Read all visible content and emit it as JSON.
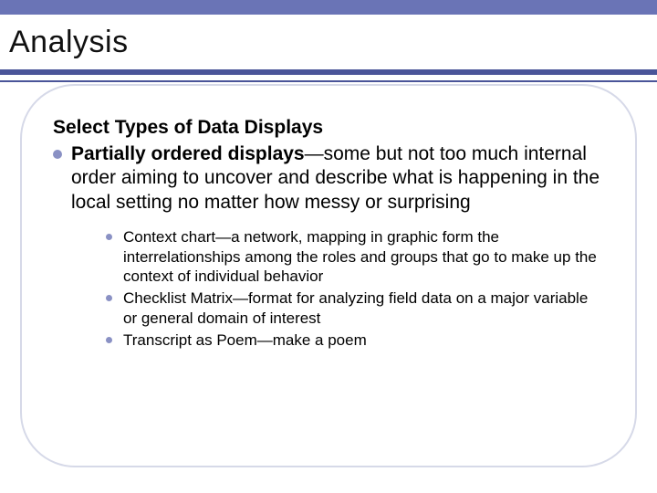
{
  "title": "Analysis",
  "heading": "Select Types of Data Displays",
  "item": {
    "label": "Partially ordered displays",
    "desc": "—some but not too much internal order aiming to uncover and describe what is happening in the local setting no matter how messy or surprising"
  },
  "subitems": [
    "Context chart—a network, mapping in graphic form the interrelationships among the roles and groups that go to make up the context of individual behavior",
    "Checklist Matrix—format for analyzing field data on a major variable or general domain of interest",
    "Transcript as Poem—make a poem"
  ]
}
